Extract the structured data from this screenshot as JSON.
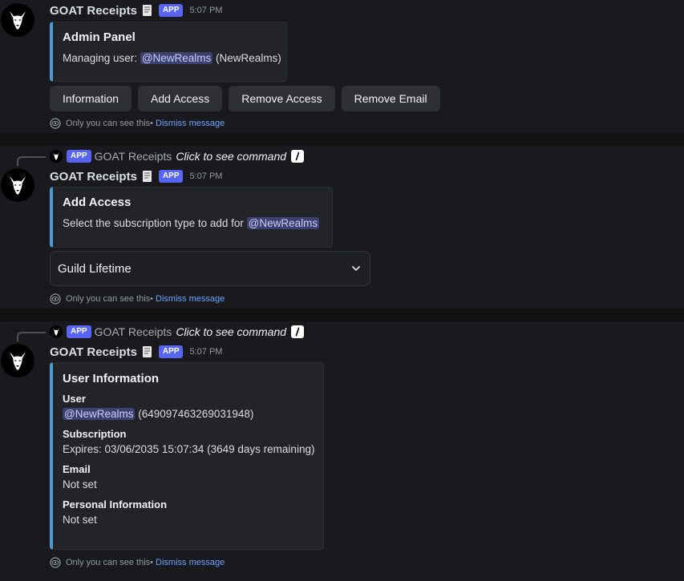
{
  "bot": {
    "name": "GOAT Receipts",
    "app_tag": "APP"
  },
  "messages": [
    {
      "timestamp": "5:07 PM",
      "embed": {
        "title": "Admin Panel",
        "desc_prefix": "Managing user: ",
        "mention": "@NewRealms",
        "desc_suffix": " (NewRealms)"
      },
      "buttons": [
        "Information",
        "Add Access",
        "Remove Access",
        "Remove Email"
      ],
      "ephemeral": {
        "text": "Only you can see this",
        "sep": " • ",
        "dismiss": "Dismiss message"
      }
    },
    {
      "reply": {
        "app_tag": "APP",
        "name": "GOAT Receipts",
        "command": "Click to see command"
      },
      "timestamp": "5:07 PM",
      "embed": {
        "title": "Add Access",
        "desc_prefix": "Select the subscription type to add for ",
        "mention": "@NewRealms"
      },
      "select": {
        "value": "Guild Lifetime"
      },
      "ephemeral": {
        "text": "Only you can see this",
        "sep": " • ",
        "dismiss": "Dismiss message"
      }
    },
    {
      "reply": {
        "app_tag": "APP",
        "name": "GOAT Receipts",
        "command": "Click to see command"
      },
      "timestamp": "5:07 PM",
      "embed": {
        "title": "User Information",
        "fields": {
          "user_name": "User",
          "user_mention": "@NewRealms",
          "user_id": " (649097463269031948)",
          "subscription_name": "Subscription",
          "subscription_value": "Expires: 03/06/2035 15:07:34 (3649 days remaining)",
          "email_name": "Email",
          "email_value": "Not set",
          "personal_name": "Personal Information",
          "personal_value": "Not set"
        }
      },
      "ephemeral": {
        "text": "Only you can see this",
        "sep": " • ",
        "dismiss": "Dismiss message"
      }
    }
  ],
  "colors": {
    "background": "#1a1a1e",
    "embed_accent": "#4b9cd3",
    "app_tag": "#5865f2",
    "mention_bg": "#3c4270",
    "link": "#6aa3ff"
  },
  "icons": [
    "goat-avatar-icon",
    "receipt-emoji-icon",
    "slash-command-icon",
    "eye-icon",
    "chevron-down-icon"
  ]
}
